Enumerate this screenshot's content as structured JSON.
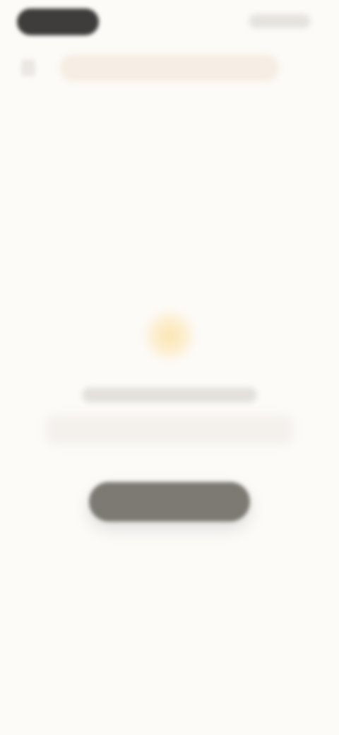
{
  "status_bar": {
    "time": "",
    "indicators": ""
  },
  "header": {
    "back_icon": "back-arrow-icon",
    "search_placeholder": ""
  },
  "empty_state": {
    "icon": "lightbulb-icon",
    "accent_color": "#f9dc92",
    "title": "",
    "description": "",
    "button_label": ""
  },
  "colors": {
    "background": "#fdfbf8",
    "button": "#7c7a72",
    "search_bar": "#f6eee4"
  }
}
